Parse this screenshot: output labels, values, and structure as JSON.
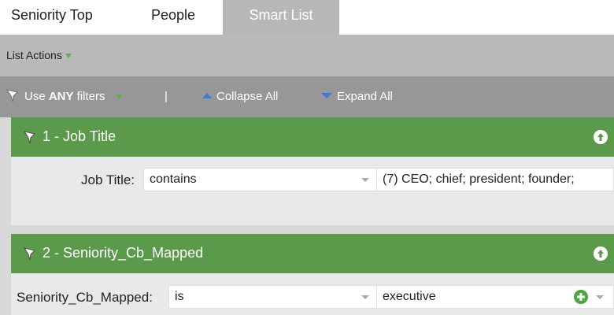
{
  "tabs": [
    {
      "label": "Seniority Top"
    },
    {
      "label": "People"
    },
    {
      "label": "Smart List"
    }
  ],
  "list_actions": {
    "label": "List Actions",
    "icon": "triangle-down-icon"
  },
  "filter_toolbar": {
    "use_prefix": "Use ",
    "use_bold": "ANY",
    "use_suffix": " filters",
    "separator": "|",
    "collapse_label": "Collapse All",
    "expand_label": "Expand All"
  },
  "filters": [
    {
      "title": "1 - Job Title",
      "field_label": "Job Title:",
      "operator": "contains",
      "value": "(7) CEO; chief; president; founder;"
    },
    {
      "title": "2 - Seniority_Cb_Mapped",
      "field_label": "Seniority_Cb_Mapped:",
      "operator": "is",
      "value": "executive"
    }
  ],
  "colors": {
    "panel_header": "#5b9a4b",
    "toolbar": "#97979a",
    "active_tab": "#b7b7b9",
    "accent_blue": "#3a7bd5",
    "add_green": "#4aa83d"
  }
}
